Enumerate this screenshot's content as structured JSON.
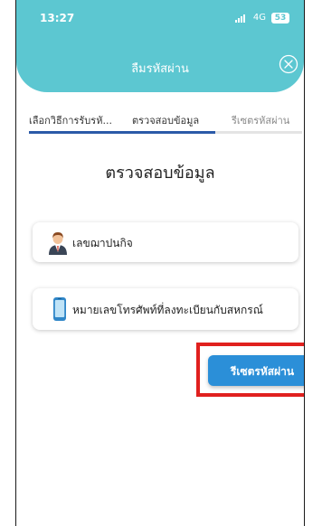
{
  "status_bar": {
    "time": "13:27",
    "network": "4G",
    "battery": "53"
  },
  "header": {
    "title": "ลืมรหัสผ่าน",
    "close_icon": "close-circle-icon"
  },
  "tabs": [
    {
      "label": "เลือกวิธีการรับรหั...",
      "state": "completed"
    },
    {
      "label": "ตรวจสอบข้อมูล",
      "state": "active"
    },
    {
      "label": "รีเซตรหัสผ่าน",
      "state": "inactive"
    }
  ],
  "section_heading": "ตรวจสอบข้อมูล",
  "cards": [
    {
      "label": "เลขฌาปนกิจ",
      "icon": "person-icon"
    },
    {
      "label": "หมายเลขโทรศัพท์ที่ลงทะเบียนกับสหกรณ์",
      "icon": "phone-icon"
    }
  ],
  "reset_button_label": "รีเซตรหัสผ่าน",
  "colors": {
    "header": "#5cc7d1",
    "tab_active": "#2b5aa8",
    "button": "#2b8fd8",
    "highlight": "#e0201e"
  }
}
